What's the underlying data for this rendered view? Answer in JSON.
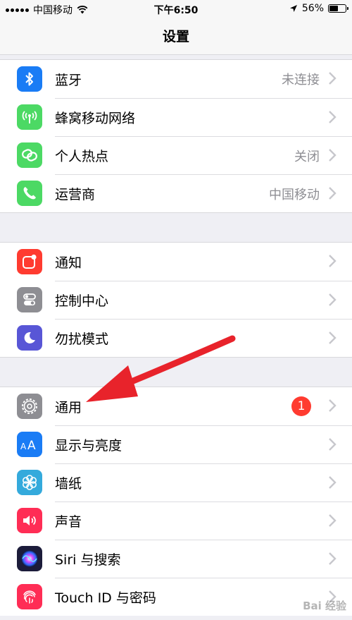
{
  "status_bar": {
    "carrier": "中国移动",
    "time": "下午6:50",
    "battery": "56%",
    "battery_level": 0.56
  },
  "nav": {
    "title": "设置"
  },
  "groups": [
    {
      "items": [
        {
          "label": "蓝牙",
          "value": "未连接",
          "icon": "bluetooth-icon",
          "color": "#1a7cf5"
        },
        {
          "label": "蜂窝移动网络",
          "value": "",
          "icon": "cellular-antenna-icon",
          "color": "#4cd964"
        },
        {
          "label": "个人热点",
          "value": "关闭",
          "icon": "personal-hotspot-icon",
          "color": "#4cd964"
        },
        {
          "label": "运营商",
          "value": "中国移动",
          "icon": "phone-icon",
          "color": "#4cd964"
        }
      ]
    },
    {
      "items": [
        {
          "label": "通知",
          "value": "",
          "icon": "notifications-icon",
          "color": "#ff3b30"
        },
        {
          "label": "控制中心",
          "value": "",
          "icon": "control-center-icon",
          "color": "#8e8e93"
        },
        {
          "label": "勿扰模式",
          "value": "",
          "icon": "moon-icon",
          "color": "#5856d6"
        }
      ]
    },
    {
      "items": [
        {
          "label": "通用",
          "value": "",
          "badge": "1",
          "icon": "gear-icon",
          "color": "#8e8e93"
        },
        {
          "label": "显示与亮度",
          "value": "",
          "icon": "display-aa-icon",
          "color": "#1a7cf5"
        },
        {
          "label": "墙纸",
          "value": "",
          "icon": "wallpaper-flower-icon",
          "color": "#34aadc"
        },
        {
          "label": "声音",
          "value": "",
          "icon": "speaker-icon",
          "color": "#ff2d55"
        },
        {
          "label": "Siri 与搜索",
          "value": "",
          "icon": "siri-icon",
          "color": "#1c1c3a"
        },
        {
          "label": "Touch ID 与密码",
          "value": "",
          "icon": "fingerprint-icon",
          "color": "#ff2d55"
        }
      ]
    }
  ],
  "annotation": {
    "color": "#e8232b"
  },
  "watermark": "Bai 经验"
}
